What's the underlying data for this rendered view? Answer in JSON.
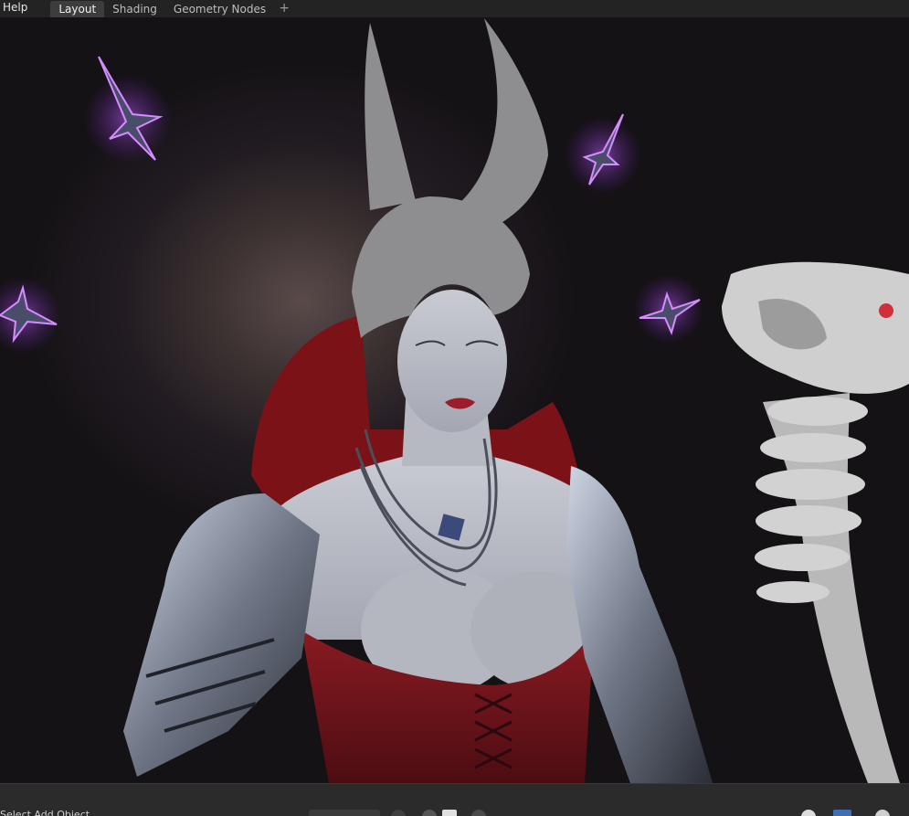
{
  "menu": {
    "help_label": "Help"
  },
  "workspace_tabs": [
    {
      "label": "Layout",
      "active": true
    },
    {
      "label": "Shading",
      "active": false
    },
    {
      "label": "Geometry Nodes",
      "active": false
    }
  ],
  "add_tab_symbol": "+",
  "viewport": {
    "scene": "3D render of horned sorceress character in armor with bone staff and glowing purple shuriken",
    "accent_glow": "#b04cff"
  },
  "statusbar": {
    "hint_text": "Select  Add  Object"
  }
}
